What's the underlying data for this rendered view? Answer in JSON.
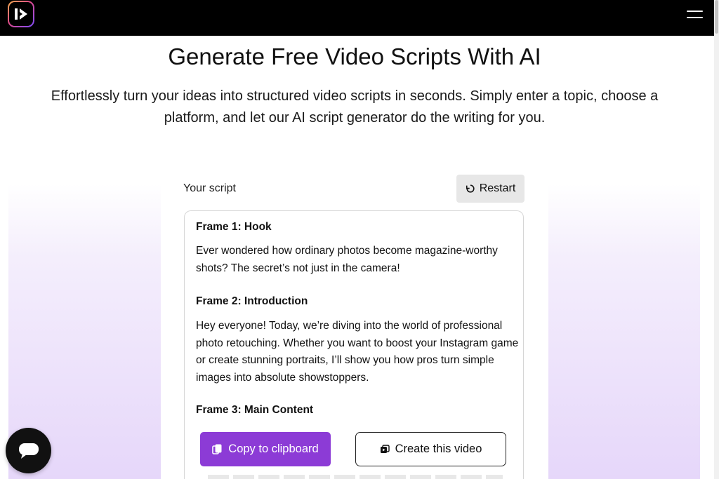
{
  "header": {
    "logo_icon": "brand-logo-icon",
    "menu_icon": "hamburger-menu-icon"
  },
  "hero": {
    "title": "Generate Free Video Scripts With AI",
    "subtitle": "Effortlessly turn your ideas into structured video scripts in seconds. Simply enter a topic, choose a platform, and let our AI script generator do the writing for you."
  },
  "script_panel": {
    "label": "Your script",
    "restart_label": "Restart",
    "frames": [
      {
        "title": "Frame 1: Hook",
        "text": "Ever wondered how ordinary photos become magazine-worthy shots? The secret’s not just in the camera!"
      },
      {
        "title": "Frame 2: Introduction",
        "text": "Hey everyone! Today, we’re diving into the world of professional photo retouching. Whether you want to boost your Instagram game or create stunning portraits, I’ll show you how pros turn simple images into absolute showstoppers."
      },
      {
        "title": "Frame 3: Main Content",
        "text": ""
      }
    ]
  },
  "actions": {
    "copy_label": "Copy to clipboard",
    "create_label": "Create this video"
  },
  "colors": {
    "accent": "#8c3bd6",
    "topbar": "#000000",
    "gradient_light": "#e6d7fa"
  },
  "chat": {
    "icon": "chat-bubble-icon"
  }
}
